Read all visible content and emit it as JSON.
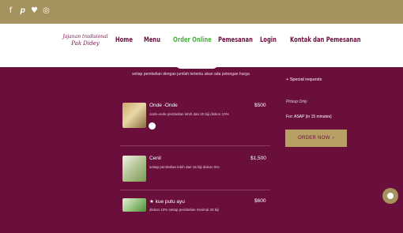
{
  "social": [
    "f",
    "𝒑",
    "♥",
    "◎"
  ],
  "brand": {
    "line1": "Jajanan tradisional",
    "line2": "Pak Didey"
  },
  "nav": [
    {
      "label": "Home"
    },
    {
      "label": "Menu"
    },
    {
      "label": "Order Online",
      "active": true
    },
    {
      "label": "Pemesanan"
    },
    {
      "label": "Login"
    },
    {
      "label": "Kontak dan Pemesanan"
    }
  ],
  "intro": "setiap pembelian dengan jumlah tertentu akan ada potongan harga",
  "items": [
    {
      "name": "Onde -Onde",
      "desc": "onde-onde pembelian lebih dari 20 biji diskon 10%",
      "price": "$500"
    },
    {
      "name": "Cenil",
      "desc": "setiap pembelian lebih dari 15 biji diskon 5%",
      "price": "$1,500"
    },
    {
      "name": "★ kue putu ayu",
      "desc": "diskon 10% setiap pembelian minimal 20 biji",
      "price": "$600"
    }
  ],
  "order": {
    "special": "+ Special requests",
    "pickup": "Pickup Only",
    "asap": "For: ASAP (in 15 minutes)",
    "button": "ORDER NOW",
    "button_arrow": "›"
  }
}
